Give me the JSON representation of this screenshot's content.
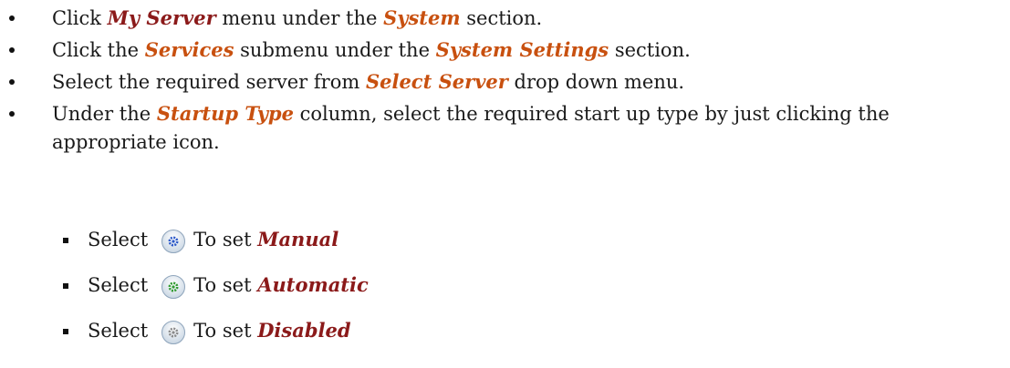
{
  "bullets": [
    {
      "pre": "Click ",
      "hl": "My Server",
      "mid": " menu under the ",
      "hl2": "System",
      "post": " section."
    },
    {
      "pre": "Click the ",
      "hl": "Services",
      "mid": " submenu under the ",
      "hl2": "System Settings",
      "post": " section."
    },
    {
      "pre": "Select the required server from ",
      "hl": "Select Server",
      "mid": " drop down menu.",
      "hl2": "",
      "post": ""
    },
    {
      "pre": "Under the ",
      "hl": "Startup Type",
      "mid": " column, select the required start up type by just clicking the appropriate icon.",
      "hl2": "",
      "post": ""
    }
  ],
  "startup_options": [
    {
      "select": "Select",
      "to_set": "To set",
      "type": "Manual",
      "icon": "gear-blue-icon",
      "color": "#2a58c8"
    },
    {
      "select": "Select",
      "to_set": "To set",
      "type": "Automatic",
      "icon": "gear-green-icon",
      "color": "#2f9a2f"
    },
    {
      "select": "Select",
      "to_set": "To set",
      "type": "Disabled",
      "icon": "gear-gray-icon",
      "color": "#8a8a8a"
    }
  ],
  "colors": {
    "highlight_red": "#8b1a1a",
    "highlight_orange": "#c8500f",
    "text": "#1a1a1a"
  }
}
